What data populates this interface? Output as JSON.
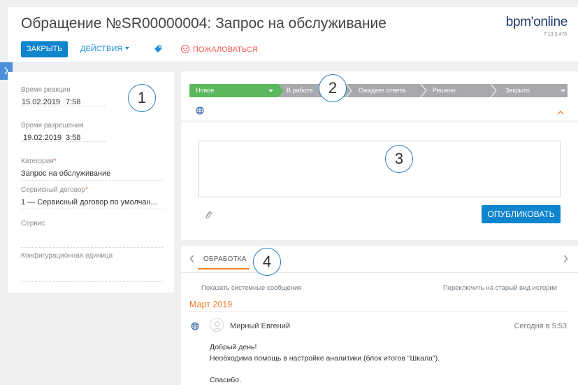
{
  "header": {
    "title": "Обращение №SR00000004: Запрос на обслуживание",
    "logo": "bpm'online",
    "version": "7.13.3.478",
    "close_label": "ЗАКРЫТЬ",
    "actions_label": "ДЕЙСТВИЯ",
    "complain_label": "ПОЖАЛОВАТЬСЯ"
  },
  "left_panel": {
    "reaction_label": "Время реакции",
    "reaction_date": "15.02.2019",
    "reaction_time": "7:58",
    "resolution_label": "Время разрешения",
    "resolution_date": "19.02.2019",
    "resolution_time": "3:58",
    "category_label": "Категория",
    "category_value": "Запрос на обслуживание",
    "contract_label": "Сервисный договор",
    "contract_value": "1 — Сервисный договор по умолчан...",
    "service_label": "Сервис",
    "config_label": "Конфигурационная единица",
    "required_mark": "*"
  },
  "stages": {
    "items": [
      "Новое",
      "В работе",
      "Ожидает ответа",
      "Решено",
      "Закрыто"
    ],
    "active_index": 0,
    "active_color": "#5cb85c",
    "inactive_color": "#a7a9ac"
  },
  "editor": {
    "publish_label": "ОПУБЛИКОВАТЬ"
  },
  "callouts": [
    "1",
    "2",
    "3",
    "4"
  ],
  "history": {
    "tab_label": "ОБРАБОТКА",
    "show_system_label": "Показать системные сообщения",
    "switch_view_label": "Переключить на старый вид истории",
    "month": "Март 2019",
    "message": {
      "author": "Мирный Евгений",
      "time": "Сегодня в 5:53",
      "lines": [
        "Добрый день!",
        "Необходима помощь в настройке аналитики (блок итогов \"Шкала\").",
        "Спасибо."
      ]
    }
  },
  "colors": {
    "accent_blue": "#0d84ce",
    "accent_orange": "#f47e2b",
    "alert_red": "#ef5a55"
  }
}
